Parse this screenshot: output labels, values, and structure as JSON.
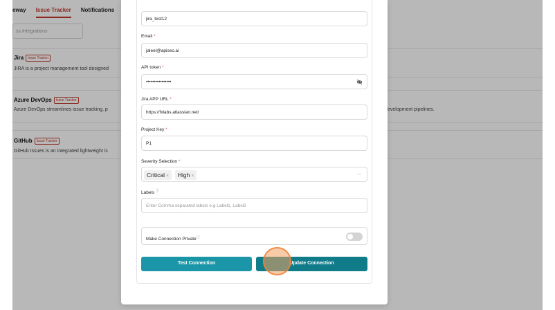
{
  "background": {
    "tabs": [
      {
        "label": "eway"
      },
      {
        "label": "Issue Tracker"
      },
      {
        "label": "Notifications"
      }
    ],
    "search_placeholder": "ss Integrations",
    "integrations": [
      {
        "name": "Jira",
        "badge": "Issue Tracker",
        "description": "JIRA is a project management tool designed"
      },
      {
        "name": "Azure DevOps",
        "badge": "Issue Tracker",
        "description": "Azure DevOps streamlines issue tracking, p",
        "description_tail": "evelopment pipelines."
      },
      {
        "name": "GitHub",
        "badge": "Issue Tracker",
        "description": "GitHub Issues is an integrated lightweight is"
      }
    ]
  },
  "form": {
    "name_value": "jira_test12",
    "email_label": "Email",
    "email_value": "jaleel@apisec.ai",
    "api_token_label": "API token",
    "api_token_value": "••••••••••••••••",
    "jira_url_label": "Jira APP URL",
    "jira_url_value": "https://fxlabs.atlassian.net/",
    "project_key_label": "Project Key",
    "project_key_value": "P1",
    "severity_label": "Severity Selection",
    "severity_tags": [
      {
        "label": "Critical",
        "remove": "×"
      },
      {
        "label": "High",
        "remove": "×"
      }
    ],
    "labels_label": "Labels",
    "labels_placeholder": "Enter Comma separated labels e.g Label1, Label2",
    "private_label": "Make Connection Private",
    "private_enabled": false,
    "required_mark": "*",
    "info_mark": "ⓘ",
    "chevron": "⌵"
  },
  "actions": {
    "test_label": "Test Connection",
    "update_label": "Update Connection"
  },
  "colors": {
    "accent_red": "#c0392b",
    "button_teal": "#1a96a8",
    "button_teal_dark": "#107c8a"
  }
}
